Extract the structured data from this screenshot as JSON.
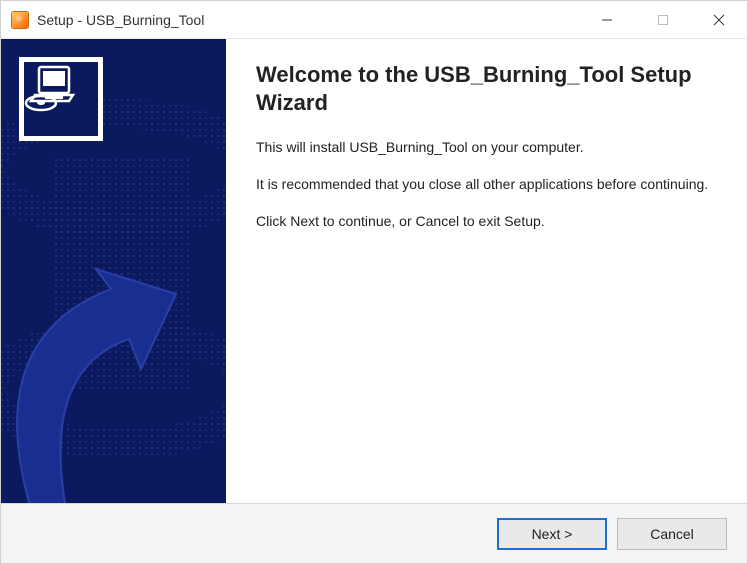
{
  "titlebar": {
    "title": "Setup - USB_Burning_Tool"
  },
  "main": {
    "heading": "Welcome to the USB_Burning_Tool Setup Wizard",
    "p1": "This will install USB_Burning_Tool on your computer.",
    "p2": "It is recommended that you close all other applications before continuing.",
    "p3": "Click Next to continue, or Cancel to exit Setup."
  },
  "footer": {
    "next_label": "Next >",
    "cancel_label": "Cancel"
  },
  "colors": {
    "accent_dark_blue": "#0b1a5e",
    "primary_button_border": "#1e6fd6"
  }
}
